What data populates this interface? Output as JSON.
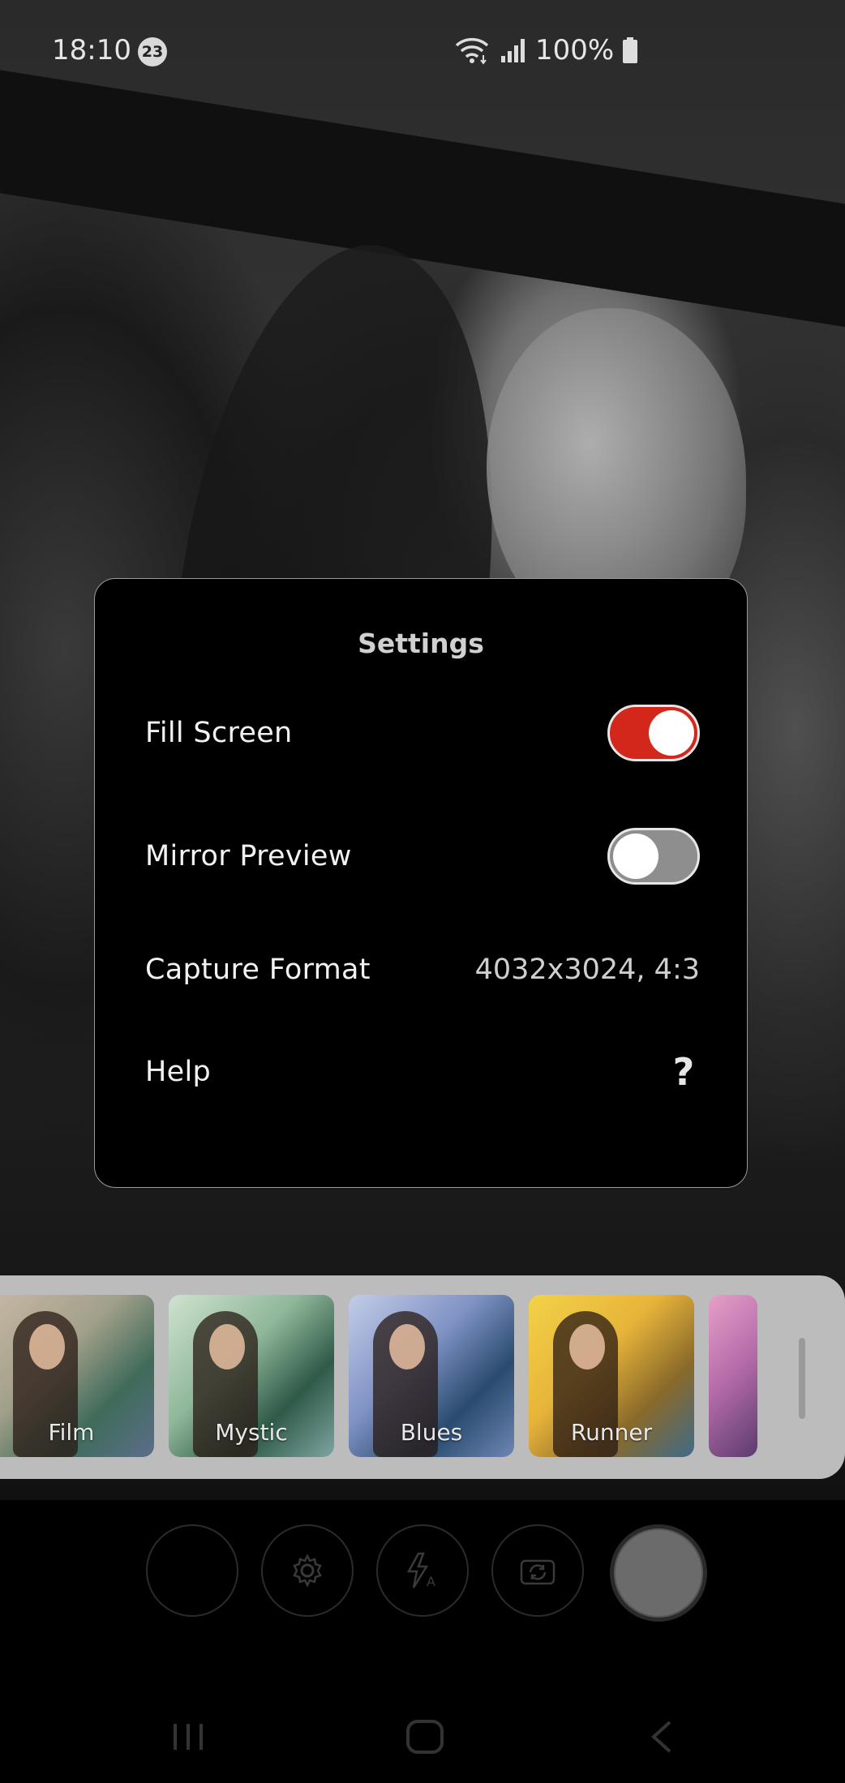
{
  "status_bar": {
    "time": "18:10",
    "notification_count": "23",
    "battery_text": "100%"
  },
  "settings": {
    "title": "Settings",
    "rows": [
      {
        "label": "Fill Screen",
        "control": "toggle",
        "on": true
      },
      {
        "label": "Mirror Preview",
        "control": "toggle",
        "on": false
      },
      {
        "label": "Capture Format",
        "value": "4032x3024, 4:3"
      },
      {
        "label": "Help",
        "value": "?"
      }
    ],
    "accent_color": "#d4271b"
  },
  "filters": [
    {
      "label": "Film"
    },
    {
      "label": "Mystic"
    },
    {
      "label": "Blues"
    },
    {
      "label": "Runner"
    },
    {
      "label": ""
    }
  ],
  "controls": {
    "icons": [
      "thumbnail-placeholder",
      "gear-icon",
      "flash-auto-icon",
      "switch-camera-icon",
      "shutter-button"
    ]
  },
  "nav": {
    "icons": [
      "recent-apps-icon",
      "home-icon",
      "back-icon"
    ]
  }
}
